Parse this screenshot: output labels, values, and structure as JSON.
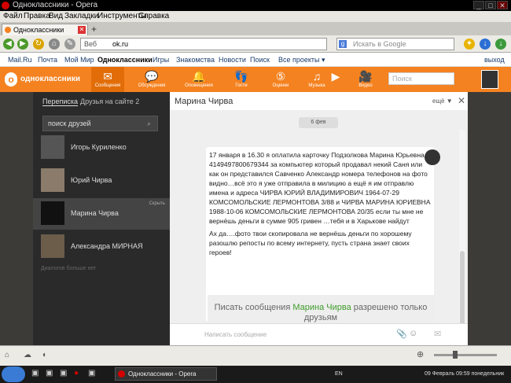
{
  "window": {
    "title": "Одноклассники - Opera"
  },
  "menu": [
    "Файл",
    "Правка",
    "Вид",
    "Закладки",
    "Инструменты",
    "Справка"
  ],
  "tab": {
    "label": "Одноклассники"
  },
  "address": {
    "label": "Веб",
    "url": "ok.ru",
    "search_placeholder": "Искать в Google"
  },
  "bookmarks": [
    "Mail.Ru",
    "Почта",
    "Мой Мир",
    "Одноклассники",
    "Игры",
    "Знакомства",
    "Новости",
    "Поиск",
    "Все проекты ▾"
  ],
  "exit_label": "выход",
  "ok": {
    "brand": "одноклассники",
    "nav": [
      "Сообщения",
      "Обсуждения",
      "Оповещения",
      "Гости",
      "Оценки",
      "Музыка",
      "Видео"
    ],
    "search_placeholder": "Поиск"
  },
  "left": {
    "tabs": [
      "Переписка",
      "Друзья на сайте 2"
    ],
    "search_placeholder": "поиск друзей",
    "friends": [
      {
        "name": "Игорь Куриленко"
      },
      {
        "name": "Юрий Чирва"
      },
      {
        "name": "Марина Чирва",
        "hide": "Скрыть"
      },
      {
        "name": "Александра МИРНАЯ"
      }
    ],
    "more": "Диалогов больше нет"
  },
  "chat": {
    "contact": "Марина Чирва",
    "more": "ещё ▼",
    "date": "6 фев",
    "message_p1": "17 января  в 16.30 я оплатила карточку Подзолкова Марина Юрьевна  4149497800679344  за компьютер который продавал некий Саня  или как он представился Савченко Александр номера телефонов на фото видно…всё это я уже отправила в милицию  а ещё я им отправлю имена и адреса   ЧИРВА    ЮРИЙ    ВЛАДИМИРОВИЧ 1964-07-29 КОМСОМОЛЬСКИЕ ЛЕРМОНТОВА 3/88  и ЧИРВА    МАРИНА    ЮРИЕВНА 1988-10-06  КОМСОМОЛЬСКИЕ    ЛЕРМОНТОВА 20/35  если ты мне не вернёшь деньги  в сумме 905 гривен …тебя и в Харькове найдут",
    "message_p2": "Ах да….фото твои скопировала не вернёшь деньги по хорошему разошлю репосты по всему интернету, пусть страна знает своих героев!",
    "write_prefix": "Писать сообщения ",
    "write_name": "Марина Чирва",
    "write_suffix": " разрешено только друзьям",
    "input_placeholder": "Написать сообщение"
  },
  "taskbar": {
    "task": "Одноклассники - Opera",
    "lang": "EN",
    "clock": "09 Февраль 09:59 понедельник"
  }
}
